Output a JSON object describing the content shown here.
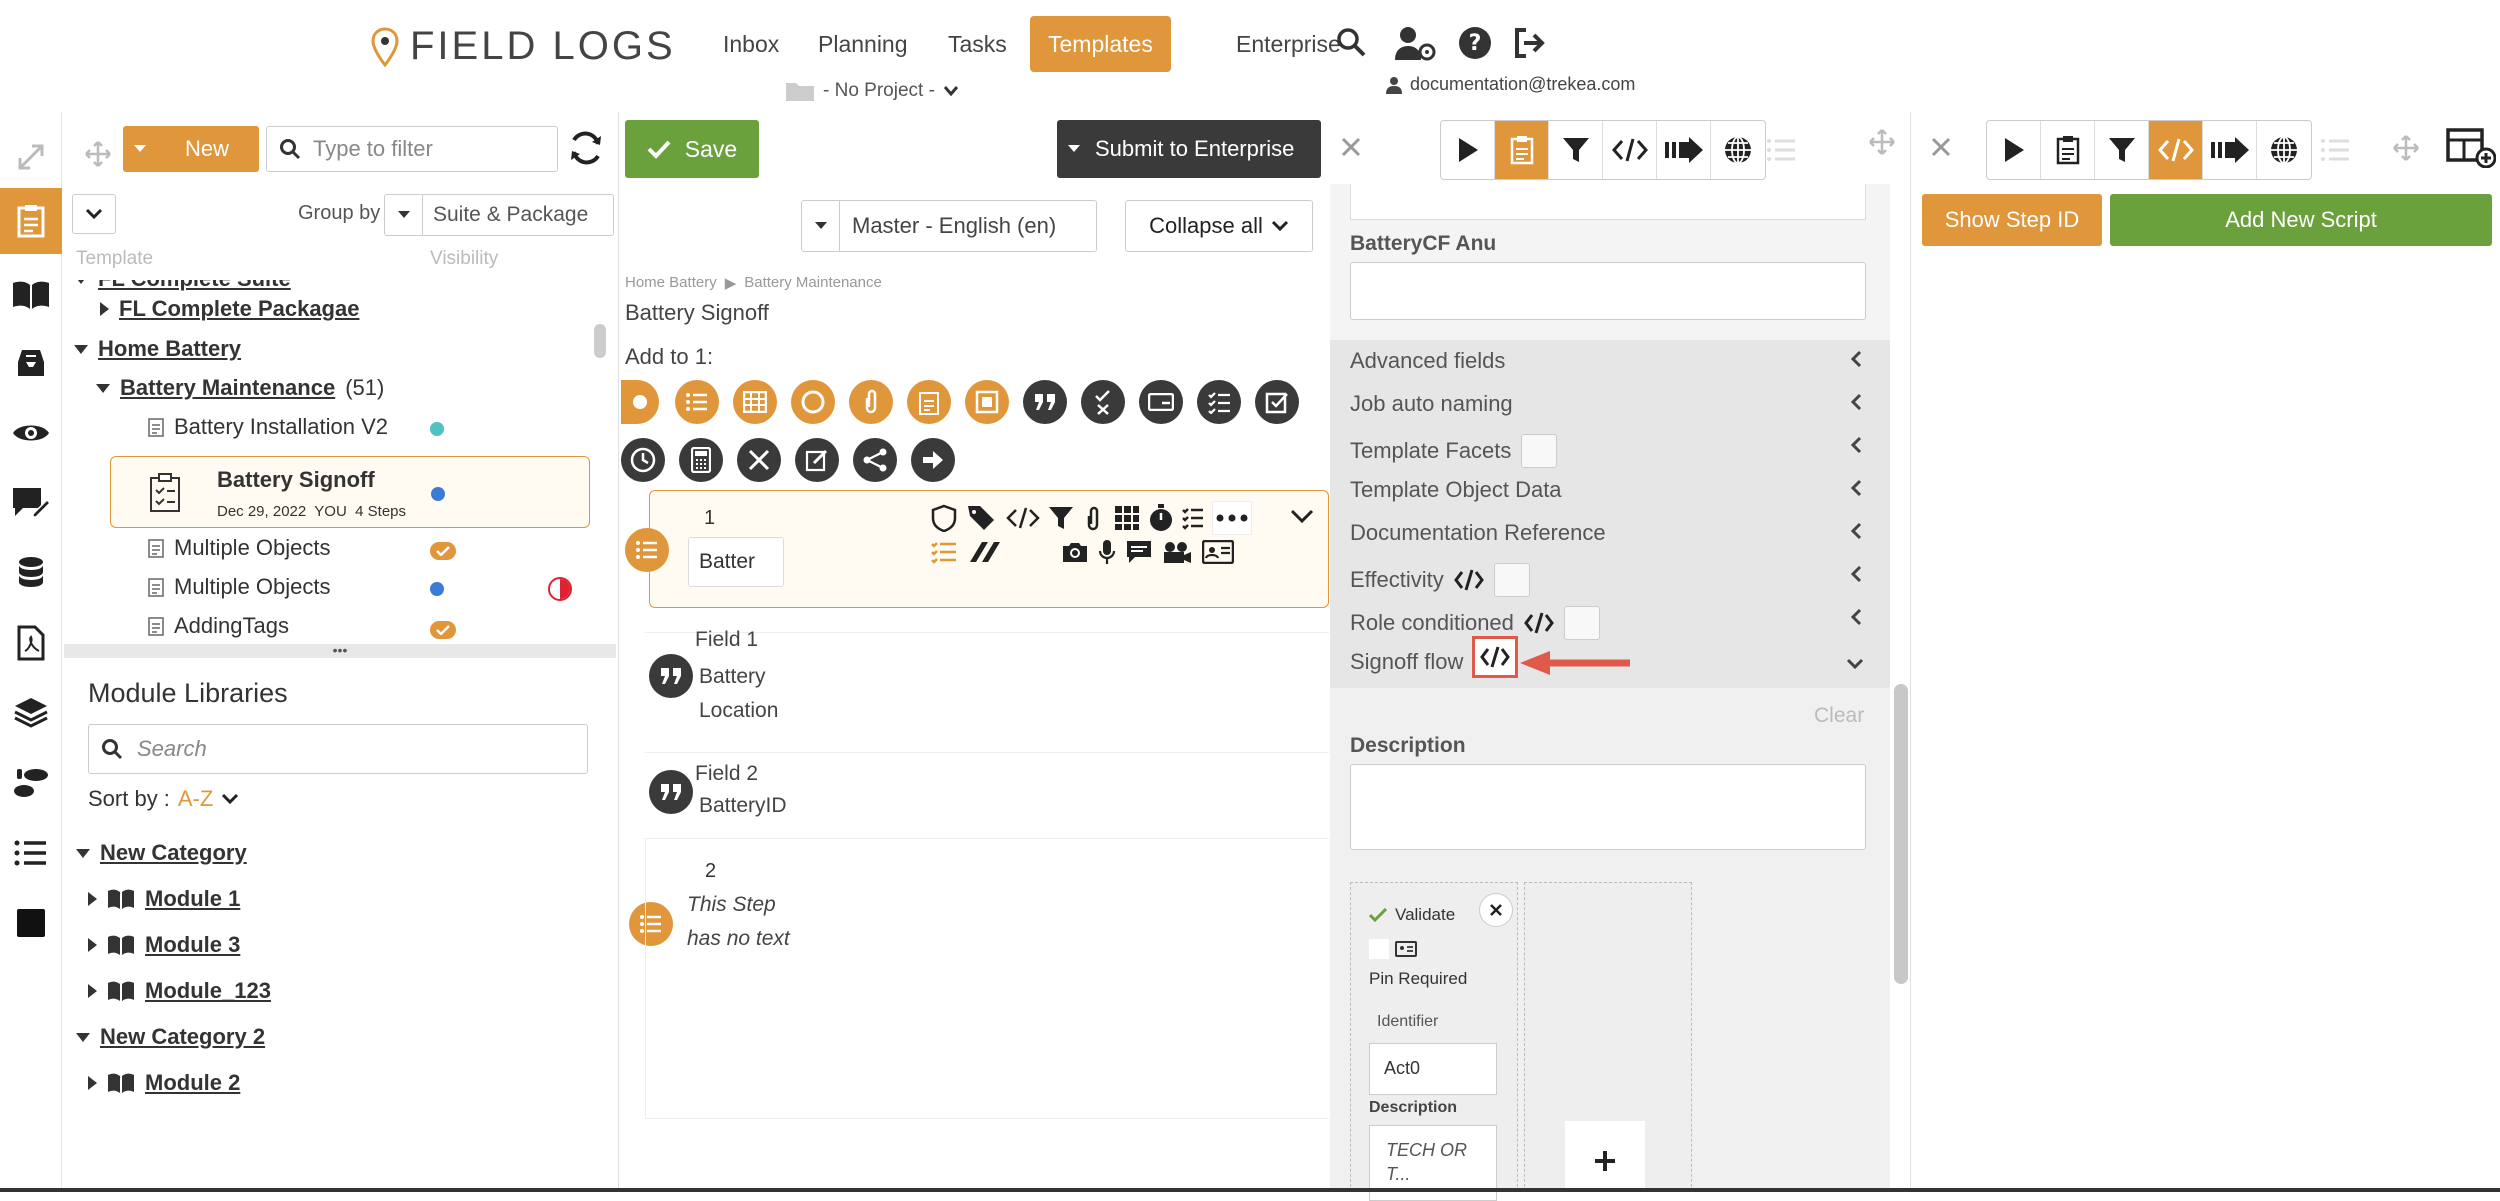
{
  "app": {
    "logo_text": "FIELD LOGS"
  },
  "nav": {
    "items": [
      "Inbox",
      "Planning",
      "Tasks",
      "Templates",
      "Enterprise"
    ],
    "active": "Templates",
    "project": "- No Project -",
    "user_email": "documentation@trekea.com"
  },
  "tree_panel": {
    "new_label": "New",
    "filter_placeholder": "Type to filter",
    "group_by_label": "Group by",
    "group_by_value": "Suite & Package",
    "col_template": "Template",
    "col_visibility": "Visibility",
    "rows": [
      {
        "label": "FL Complete Suite"
      },
      {
        "label": "FL Complete Packagae"
      },
      {
        "label": "Home Battery"
      },
      {
        "label": "Battery Maintenance",
        "count": "(51)"
      },
      {
        "label": "Battery Installation V2"
      },
      {
        "label": "Battery Signoff",
        "meta": "Dec 29, 2022  YOU  4 Steps"
      },
      {
        "label": "Multiple Objects"
      },
      {
        "label": "Multiple Objects"
      },
      {
        "label": "AddingTags"
      }
    ],
    "more": "•••"
  },
  "modlib": {
    "title": "Module Libraries",
    "search_placeholder": "Search",
    "sort_label": "Sort by :",
    "sort_value": "A-Z",
    "items": [
      "New Category",
      "Module 1",
      "Module 3",
      "Module_123",
      "New Category 2",
      "Module 2"
    ]
  },
  "editor": {
    "save_label": "Save",
    "submit_label": "Submit to Enterprise",
    "language": "Master - English (en)",
    "collapse_label": "Collapse all",
    "breadcrumb": [
      "Home Battery",
      "Battery Maintenance"
    ],
    "title": "Battery Signoff",
    "add_to": "Add to 1:",
    "step1_num": "1",
    "step1_text": "Batter",
    "field1_label": "Field 1",
    "field1_text": "Battery Location",
    "field2_label": "Field 2",
    "field2_text": "BatteryID",
    "step2_num": "2",
    "step2_text": "This Step has no text"
  },
  "props": {
    "battery_cf_label": "BatteryCF Anu",
    "rows": [
      "Advanced fields",
      "Job auto naming",
      "Template Facets",
      "Template Object Data",
      "Documentation Reference",
      "Effectivity",
      "Role conditioned",
      "Signoff flow"
    ],
    "clear": "Clear",
    "description_label": "Description",
    "validate": "Validate",
    "pin_required": "Pin Required",
    "identifier_label": "Identifier",
    "identifier_value": "Act0",
    "desc_label2": "Description",
    "desc_value": "TECH OR T..."
  },
  "far_right": {
    "show_step_id": "Show Step ID",
    "add_script": "Add New Script"
  },
  "colors": {
    "accent": "#e0963a",
    "green": "#6aa13d",
    "dark": "#3a3a3a",
    "highlight": "#e05a4a"
  }
}
